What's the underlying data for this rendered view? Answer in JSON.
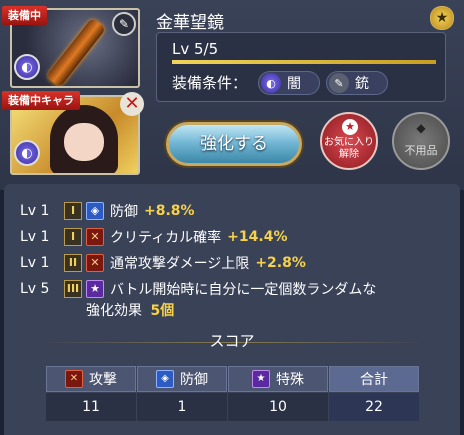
{
  "item": {
    "name": "金華望鏡",
    "level": "Lv 5/5",
    "equip_condition_label": "装備条件：",
    "conditions": [
      {
        "label": "闇"
      },
      {
        "label": "銃"
      }
    ]
  },
  "tags": {
    "equipped": "装備中",
    "equipped_char": "装備中キャラ"
  },
  "buttons": {
    "enhance": "強化する",
    "favorite_line1": "お気に入り",
    "favorite_line2": "解除",
    "junk": "不用品"
  },
  "skills": [
    {
      "lv": "Lv 1",
      "rank": "I",
      "icon": "shield-icon",
      "name": "防御",
      "value": "+8.8%"
    },
    {
      "lv": "Lv 1",
      "rank": "I",
      "icon": "attack-icon",
      "name": "クリティカル確率",
      "value": "+14.4%"
    },
    {
      "lv": "Lv 1",
      "rank": "II",
      "icon": "attack-icon",
      "name": "通常攻撃ダメージ上限",
      "value": "+2.8%"
    },
    {
      "lv": "Lv 5",
      "rank": "III",
      "icon": "special-icon",
      "name": "バトル開始時に自分に一定個数ランダムな",
      "name2": "強化効果",
      "value": "5個"
    }
  ],
  "score": {
    "title": "スコア",
    "columns": [
      {
        "label": "攻撃",
        "value": "11"
      },
      {
        "label": "防御",
        "value": "1"
      },
      {
        "label": "特殊",
        "value": "10"
      },
      {
        "label": "合計",
        "value": "22"
      }
    ]
  },
  "colors": {
    "accent_gold": "#f6d24a",
    "panel": "#3a4258",
    "background": "#1c2235"
  }
}
